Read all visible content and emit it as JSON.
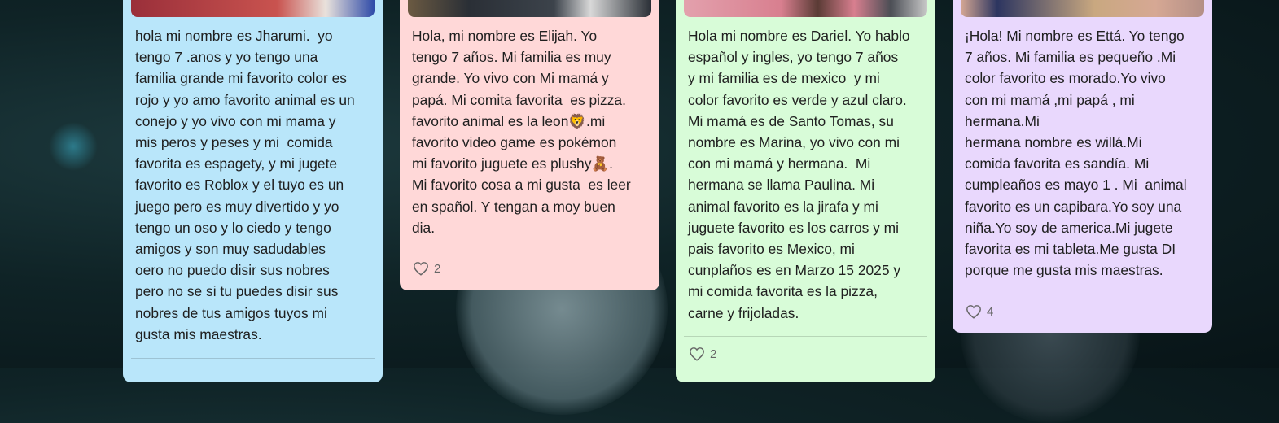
{
  "cards": [
    {
      "text": "hola mi nombre es Jharumi.  yo\ntengo 7 .anos y yo tengo una\nfamilia grande mi favorito color es\nrojo y yo amo favorito animal es un\nconejo y yo vivo con mi mama y\nmis peros y peses y mi  comida\nfavorita es espagety, y mi jugete\nfavorito es Roblox y el tuyo es un\njuego pero es muy divertido y yo\ntengo un oso y lo ciedo y tengo\namigos y son muy sadudables\noero no puedo disir sus nobres\npero no se si tu puedes disir sus\nnobres de tus amigos tuyos mi\ngusta mis maestras.",
      "color": "#b9e6fa"
    },
    {
      "text_a": "Hola, mi nombre es Elijah. Yo\ntengo 7 años. Mi familia es muy\ngrande. Yo vivo con Mi mamá y\npapá. Mi comita favorita  es pizza.\nfavorito animal es la leon",
      "emoji1": "🦁",
      "text_b": ".mi\nfavorito video game es pokémon\nmi favorito juguete es plushy",
      "emoji2": "🧸",
      "text_c": ".\nMi favorito cosa a mi gusta  es leer\nen spañol. Y tengan a moy buen\ndia.",
      "likes": "2",
      "color": "#ffd8d8"
    },
    {
      "text": "Hola mi nombre es Dariel. Yo hablo\nespañol y ingles, yo tengo 7 años\ny mi familia es de mexico  y mi\ncolor favorito es verde y azul claro.\nMi mamá es de Santo Tomas, su\nnombre es Marina, yo vivo con mi\ncon mi mamá y hermana.  Mi\nhermana se llama Paulina. Mi\nanimal favorito es la jirafa y mi\njuguete favorito es los carros y mi\npais favorito es Mexico, mi\ncunplaños es en Marzo 15 2025 y\nmi comida favorita es la pizza,\ncarne y frijoladas.",
      "likes": "2",
      "color": "#d8fcd8"
    },
    {
      "text_a": "¡Hola! Mi nombre es Ettá. Yo tengo\n7 años. Mi familia es pequeño .Mi\ncolor favorito es morado.Yo vivo\ncon mi mamá ,mi papá , mi\nhermana.Mi\nhermana nombre es willá.Mi\ncomida favorita es sandía. Mi\ncumpleaños es mayo 1 . Mi  animal\nfavorito es un capibara.Yo soy una\nniña.Yo soy de america.Mi jugete\nfavorita es mi ",
      "link": "tableta.Me",
      "text_b": " gusta DI\nporque me gusta mis maestras.",
      "likes": "4",
      "color": "#e9d8fd"
    }
  ]
}
